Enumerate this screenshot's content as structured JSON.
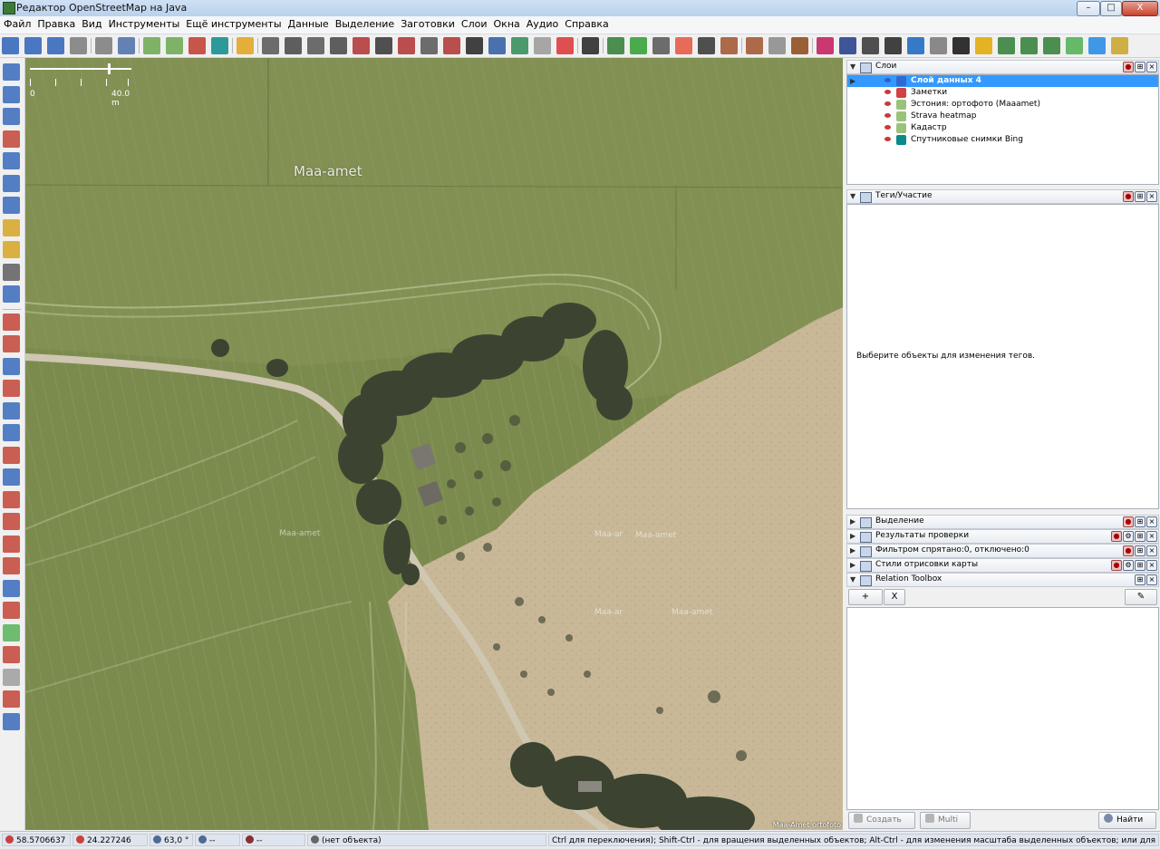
{
  "window": {
    "title": "Редактор OpenStreetMap на Java",
    "minimize_label": "–",
    "maximize_label": "□",
    "close_label": "X"
  },
  "menu": [
    "Файл",
    "Правка",
    "Вид",
    "Инструменты",
    "Ещё инструменты",
    "Данные",
    "Выделение",
    "Заготовки",
    "Слои",
    "Окна",
    "Аудио",
    "Справка"
  ],
  "toolbar": {
    "icons": [
      "open-file-icon",
      "upload-icon",
      "download-icon",
      "undo-icon",
      "redo-icon",
      "zoom-preferences-icon",
      "imagery-add-icon",
      "imagery-offset-icon",
      "remote-control-icon",
      "bing-icon",
      "traffic-light-icon",
      "road-icon",
      "building-icon",
      "wall-icon",
      "door-icon",
      "brick-icon",
      "railway-icon",
      "barrier-icon",
      "pattern-icon",
      "fence-icon",
      "car-icon",
      "parking-icon",
      "globe-icon",
      "circle-icon",
      "flag-russia-icon",
      "theatre-icon",
      "picture-icon",
      "plus-medical-icon",
      "bowl-icon",
      "balloons-icon",
      "phone-icon",
      "castle-icon",
      "factory-icon",
      "church-icon",
      "restaurant-icon",
      "shop-cart-icon",
      "shirt-icon",
      "atm-icon",
      "dollar-icon",
      "lab-icon",
      "paperclip-icon",
      "person-icon",
      "beer-icon",
      "tree-icon",
      "forest-icon",
      "shrub-icon",
      "grass-icon",
      "water-icon",
      "wheat-icon"
    ]
  },
  "left_tools": {
    "icons": [
      "lasso-icon",
      "select-icon",
      "zoom-icon",
      "delete-icon",
      "draw-nodes-icon",
      "improve-way-icon",
      "split-way-icon",
      "measure-icon",
      "pencil-icon",
      "building-tool-icon",
      "more-tools-icon",
      "layers-toggle-icon",
      "properties-toggle-icon",
      "selection-list-icon",
      "commands-list-icon",
      "history-icon",
      "relations-icon",
      "validation-icon",
      "conflicts-icon",
      "filter-icon",
      "map-style-icon",
      "download-area-icon",
      "notes-icon",
      "relation-toolbox-icon",
      "tags-edit-icon",
      "changesets-icon",
      "tasks-icon",
      "wiki-icon",
      "barcode-icon",
      "more-panels-icon"
    ]
  },
  "map": {
    "scale_left": "0",
    "scale_right": "40.0 m",
    "watermark_main": "Maa-amet",
    "watermark_small": [
      "Maa-amet",
      "Maa-ar",
      "Maa-amet",
      "Maa-ar",
      "Maa-amet"
    ],
    "attribution": "Maa-Amet ortofoto"
  },
  "imagery": {
    "base_colors": {
      "field_green": "#7b8b4e",
      "field_dry": "#c8b897",
      "road": "#cfc7b1",
      "trees": "#3c4431"
    }
  },
  "layers_panel": {
    "title": "Слои",
    "layers": [
      {
        "name": "Слой данных 4",
        "selected": true,
        "icon_color": "#2f6ad0"
      },
      {
        "name": "Заметки",
        "selected": false,
        "icon_color": "#d64040"
      },
      {
        "name": "Эстония: ортофото (Maaamet)",
        "selected": false,
        "icon_color": "#9bc27a"
      },
      {
        "name": "Strava heatmap",
        "selected": false,
        "icon_color": "#9bc27a"
      },
      {
        "name": "Кадастр",
        "selected": false,
        "icon_color": "#9bc27a"
      },
      {
        "name": "Спутниковые снимки Bing",
        "selected": false,
        "icon_color": "#0a8a8a"
      }
    ]
  },
  "tags_panel": {
    "title": "Теги/Участие",
    "hint": "Выберите объекты для изменения тегов."
  },
  "collapsed_panels": [
    "Выделение",
    "Результаты проверки",
    "Фильтром спрятано:0, отключено:0",
    "Стили отрисовки карты"
  ],
  "relation_toolbox": {
    "title": "Relation Toolbox",
    "add_label": "+",
    "remove_label": "X",
    "edit_label": "✎",
    "create_label": "Создать",
    "multi_label": "Multi",
    "find_label": "Найти"
  },
  "status": {
    "lat": "58.5706637",
    "lon": "24.227246",
    "heading": "63,0 °",
    "angle": "--",
    "distance": "--",
    "object": "(нет объекта)",
    "help": "Ctrl для переключения); Shift-Ctrl - для вращения выделенных объектов; Alt-Ctrl - для изменения масштаба выделенных объектов; или для изменения выделения"
  }
}
